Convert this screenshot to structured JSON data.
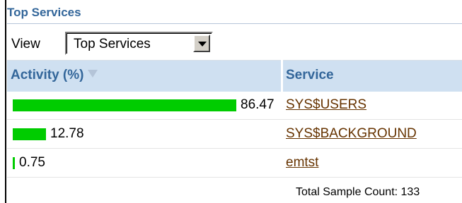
{
  "title": "Top Services",
  "view": {
    "label": "View",
    "selected": "Top Services"
  },
  "table": {
    "columns": [
      "Activity (%)",
      "Service"
    ],
    "rows": [
      {
        "activity": "86.47",
        "activity_pct": 86.47,
        "service": "SYS$USERS"
      },
      {
        "activity": "12.78",
        "activity_pct": 12.78,
        "service": "SYS$BACKGROUND"
      },
      {
        "activity": "0.75",
        "activity_pct": 0.75,
        "service": "emtst"
      }
    ]
  },
  "footer": "Total Sample Count: 133",
  "colors": {
    "bar": "#00cc00",
    "header_bg": "#cfe0f1",
    "title": "#33669a",
    "link": "#663300"
  }
}
